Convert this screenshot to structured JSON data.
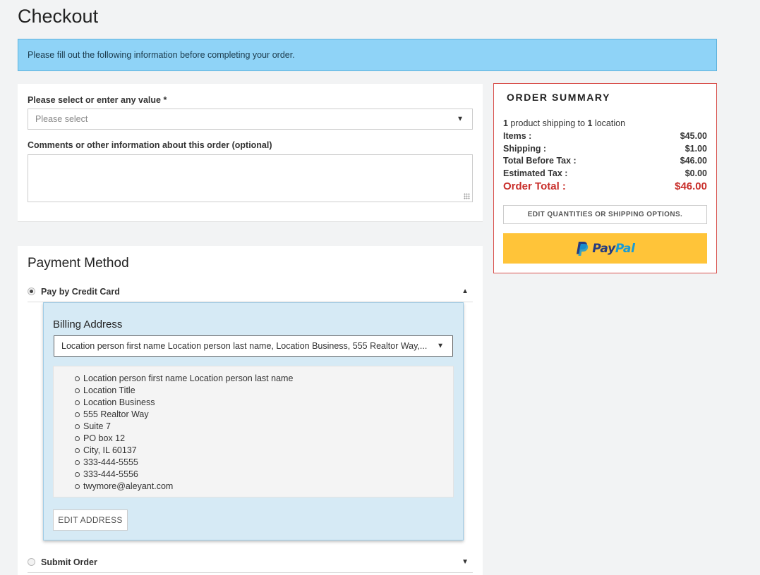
{
  "page": {
    "title": "Checkout"
  },
  "banner": {
    "text": "Please fill out the following information before completing your order."
  },
  "form": {
    "select_label": "Please select or enter any value *",
    "select_placeholder": "Please select",
    "comments_label": "Comments or other information about this order (optional)",
    "comments_value": ""
  },
  "payment": {
    "title": "Payment Method",
    "options": [
      {
        "label": "Pay by Credit Card",
        "selected": true,
        "expanded": true
      },
      {
        "label": "Submit Order",
        "selected": false,
        "expanded": false
      }
    ],
    "billing": {
      "title": "Billing Address",
      "selected_address": "Location person first name Location person last name, Location Business, 555 Realtor Way,...",
      "address_lines": [
        "Location person first name Location person last name",
        "Location Title",
        "Location Business",
        "555 Realtor Way",
        "Suite 7",
        "PO box 12",
        "City, IL 60137",
        "333-444-5555",
        "333-444-5556",
        "twymore@aleyant.com"
      ],
      "edit_label": "EDIT ADDRESS"
    }
  },
  "summary": {
    "title": "ORDER SUMMARY",
    "product_count": "1",
    "shipping_text_1": " product shipping to ",
    "location_count": "1",
    "shipping_text_2": " location",
    "rows": [
      {
        "label": "Items :",
        "value": "$45.00"
      },
      {
        "label": "Shipping :",
        "value": "$1.00"
      },
      {
        "label": "Total Before Tax :",
        "value": "$46.00"
      },
      {
        "label": "Estimated Tax :",
        "value": "$0.00"
      }
    ],
    "total_label": "Order Total :",
    "total_value": "$46.00",
    "edit_button": "EDIT QUANTITIES OR SHIPPING OPTIONS.",
    "paypal": {
      "word_1": "Pay",
      "word_2": "Pal",
      "color_bg": "#ffc439",
      "color_dark": "#253b80",
      "color_light": "#179bd7"
    }
  },
  "colors": {
    "banner": "#8fd3f7",
    "summary_border": "#d9534f",
    "total": "#c9302c",
    "billing_panel": "#d6eaf5"
  }
}
